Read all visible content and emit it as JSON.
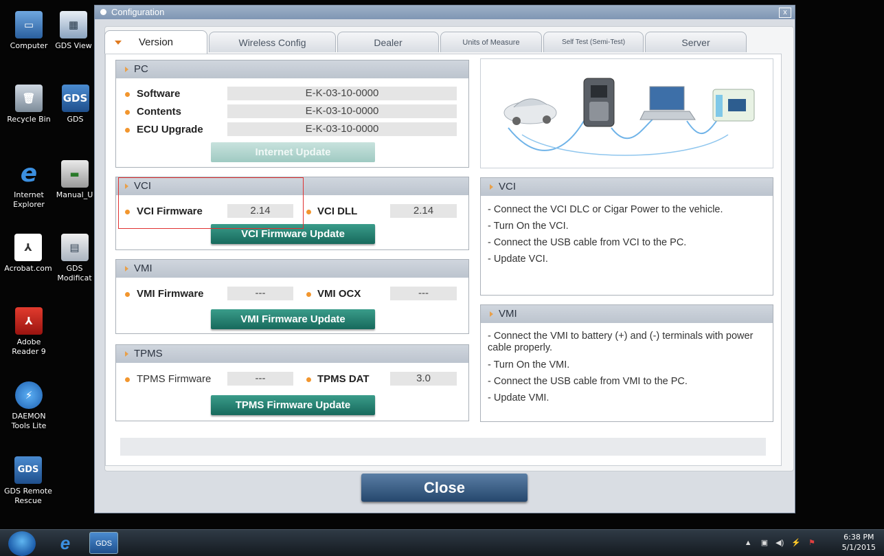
{
  "desktop": {
    "icons": [
      {
        "label": "Computer"
      },
      {
        "label": "GDS View"
      },
      {
        "label": "Recycle Bin"
      },
      {
        "label": "GDS"
      },
      {
        "label": "Internet Explorer"
      },
      {
        "label": "Manual_U"
      },
      {
        "label": "Acrobat.com"
      },
      {
        "label": "GDS Modificat"
      },
      {
        "label": "Adobe Reader 9"
      },
      {
        "label": "DAEMON Tools Lite"
      },
      {
        "label": "GDS Remote Rescue"
      }
    ]
  },
  "window": {
    "title": "Configuration",
    "close_glyph": "x"
  },
  "tabs": [
    {
      "label": "Version"
    },
    {
      "label": "Wireless Config"
    },
    {
      "label": "Dealer"
    },
    {
      "label": "Units of Measure"
    },
    {
      "label": "Self Test (Semi-Test)"
    },
    {
      "label": "Server"
    }
  ],
  "pc": {
    "title": "PC",
    "software_label": "Software",
    "software_value": "E-K-03-10-0000",
    "contents_label": "Contents",
    "contents_value": "E-K-03-10-0000",
    "ecu_label": "ECU Upgrade",
    "ecu_value": "E-K-03-10-0000",
    "update_button": "Internet Update"
  },
  "vci": {
    "title": "VCI",
    "firmware_label": "VCI Firmware",
    "firmware_value": "2.14",
    "dll_label": "VCI DLL",
    "dll_value": "2.14",
    "update_button": "VCI Firmware Update"
  },
  "vmi": {
    "title": "VMI",
    "firmware_label": "VMI Firmware",
    "firmware_value": "---",
    "ocx_label": "VMI OCX",
    "ocx_value": "---",
    "update_button": "VMI Firmware Update"
  },
  "tpms": {
    "title": "TPMS",
    "firmware_label": "TPMS Firmware",
    "firmware_value": "---",
    "dat_label": "TPMS DAT",
    "dat_value": "3.0",
    "update_button": "TPMS Firmware Update"
  },
  "vci_info": {
    "title": "VCI",
    "lines": [
      "- Connect the VCI DLC or Cigar Power to the vehicle.",
      "- Turn On the VCI.",
      "- Connect the USB cable from VCI to the PC.",
      "- Update VCI."
    ]
  },
  "vmi_info": {
    "title": "VMI",
    "lines": [
      "- Connect the VMI to battery (+) and (-) terminals with power cable properly.",
      "- Turn On the VMI.",
      "- Connect the USB cable from VMI to the PC.",
      "- Update VMI."
    ]
  },
  "close_button": "Close",
  "taskbar": {
    "gds_item": "GDS",
    "time": "6:38 PM",
    "date": "5/1/2015"
  },
  "colors": {
    "accent_orange": "#f2962e",
    "button_green": "#17695c",
    "close_blue": "#25476d",
    "highlight_red": "#e03030"
  }
}
